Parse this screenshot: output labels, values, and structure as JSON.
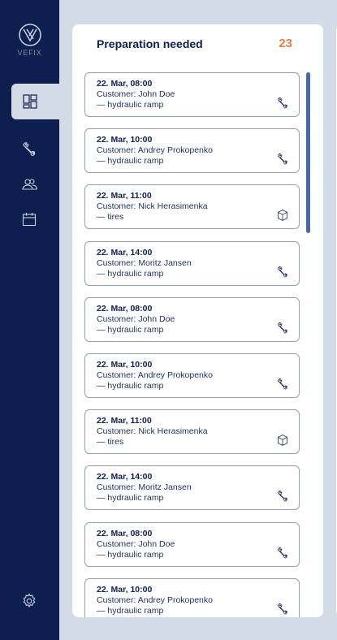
{
  "brand": {
    "name": "VEFIX"
  },
  "nav": {
    "items": [
      {
        "icon": "dashboard-icon",
        "active": true
      },
      {
        "icon": "wrench-icon",
        "active": false
      },
      {
        "icon": "users-icon",
        "active": false
      },
      {
        "icon": "calendar-icon",
        "active": false
      }
    ],
    "settings_icon": "gear-icon"
  },
  "panel": {
    "title": "Preparation needed",
    "count": "23"
  },
  "orders": [
    {
      "time": "22. Mar, 08:00",
      "customer": "Customer: John Doe",
      "service": "— hydraulic ramp",
      "icon": "wrench-icon"
    },
    {
      "time": "22. Mar, 10:00",
      "customer": "Customer: Andrey Prokopenko",
      "service": "— hydraulic ramp",
      "icon": "wrench-icon"
    },
    {
      "time": "22. Mar, 11:00",
      "customer": "Customer: Nick Herasimenka",
      "service": "— tires",
      "icon": "box-icon"
    },
    {
      "time": "22. Mar, 14:00",
      "customer": "Customer: Moritz Jansen",
      "service": "— hydraulic ramp",
      "icon": "wrench-icon"
    },
    {
      "time": "22. Mar, 08:00",
      "customer": "Customer: John Doe",
      "service": "— hydraulic ramp",
      "icon": "wrench-icon"
    },
    {
      "time": "22. Mar, 10:00",
      "customer": "Customer: Andrey Prokopenko",
      "service": "— hydraulic ramp",
      "icon": "wrench-icon"
    },
    {
      "time": "22. Mar, 11:00",
      "customer": "Customer: Nick Herasimenka",
      "service": "— tires",
      "icon": "box-icon"
    },
    {
      "time": "22. Mar, 14:00",
      "customer": "Customer: Moritz Jansen",
      "service": "— hydraulic ramp",
      "icon": "wrench-icon"
    },
    {
      "time": "22. Mar, 08:00",
      "customer": "Customer: John Doe",
      "service": "— hydraulic ramp",
      "icon": "wrench-icon"
    },
    {
      "time": "22. Mar, 10:00",
      "customer": "Customer: Andrey Prokopenko",
      "service": "— hydraulic ramp",
      "icon": "wrench-icon"
    }
  ],
  "colors": {
    "sidebar": "#0d1f4f",
    "background": "#d3dbe6",
    "accent": "#f07a45",
    "card_border": "#8fa0bd",
    "scroll_thumb": "#4a69a8"
  }
}
